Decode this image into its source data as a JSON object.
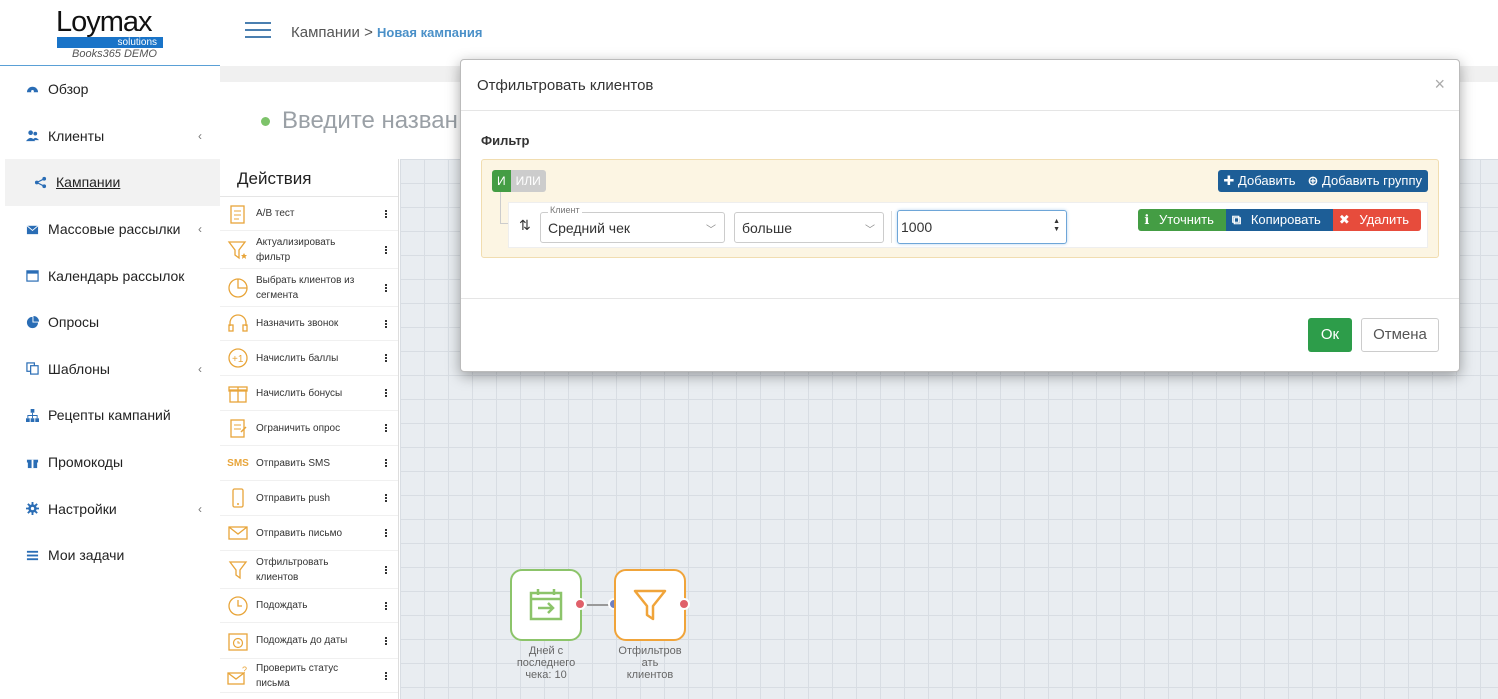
{
  "logo": {
    "brand": "Loymax",
    "tagline": "solutions",
    "instance": "Books365 DEMO"
  },
  "sidebar": {
    "items": [
      {
        "label": "Обзор",
        "icon": "dashboard-icon",
        "chevron": false
      },
      {
        "label": "Клиенты",
        "icon": "users-icon",
        "chevron": true
      },
      {
        "label": "Кампании",
        "icon": "share-icon",
        "chevron": false,
        "active": true
      },
      {
        "label": "Массовые рассылки",
        "icon": "envelope-icon",
        "chevron": true
      },
      {
        "label": "Календарь рассылок",
        "icon": "calendar-icon",
        "chevron": false
      },
      {
        "label": "Опросы",
        "icon": "pie-chart-icon",
        "chevron": false
      },
      {
        "label": "Шаблоны",
        "icon": "copy-icon",
        "chevron": true
      },
      {
        "label": "Рецепты кампаний",
        "icon": "sitemap-icon",
        "chevron": false
      },
      {
        "label": "Промокоды",
        "icon": "gift-icon",
        "chevron": false
      },
      {
        "label": "Настройки",
        "icon": "gear-icon",
        "chevron": true
      },
      {
        "label": "Мои задачи",
        "icon": "tasks-icon",
        "chevron": false
      }
    ]
  },
  "header": {
    "breadcrumb_root": "Кампании",
    "breadcrumb_sep": ">",
    "breadcrumb_current": "Новая кампания"
  },
  "campaign": {
    "name_placeholder": "Введите назван"
  },
  "actions": {
    "title": "Действия",
    "items": [
      {
        "label": "A/B тест",
        "icon": "ab-test-icon"
      },
      {
        "label": "Актуализировать фильтр",
        "icon": "filter-star-icon"
      },
      {
        "label": "Выбрать клиентов из сегмента",
        "icon": "segment-pie-icon"
      },
      {
        "label": "Назначить звонок",
        "icon": "headset-icon"
      },
      {
        "label": "Начислить баллы",
        "icon": "plus-one-icon"
      },
      {
        "label": "Начислить бонусы",
        "icon": "gift-icon"
      },
      {
        "label": "Ограничить опрос",
        "icon": "survey-icon"
      },
      {
        "label": "Отправить SMS",
        "icon": "sms-icon"
      },
      {
        "label": "Отправить push",
        "icon": "mobile-icon"
      },
      {
        "label": "Отправить письмо",
        "icon": "envelope-icon"
      },
      {
        "label": "Отфильтровать клиентов",
        "icon": "filter-icon"
      },
      {
        "label": "Подождать",
        "icon": "clock-icon"
      },
      {
        "label": "Подождать до даты",
        "icon": "calendar-clock-icon"
      },
      {
        "label": "Проверить статус письма",
        "icon": "mail-question-icon"
      }
    ]
  },
  "canvas": {
    "nodes": [
      {
        "label": "Дней с последнего чека: 10",
        "icon": "calendar-arrow-icon",
        "color": "#8cc46a"
      },
      {
        "label": "Отфильтровать клиентов",
        "label_lines": [
          "Отфильтров",
          "ать",
          "клиентов"
        ],
        "icon": "filter-icon",
        "color": "#f0a43a"
      }
    ]
  },
  "modal": {
    "title": "Отфильтровать клиентов",
    "close": "×",
    "filter_label": "Фильтр",
    "and_label": "И",
    "or_label": "ИЛИ",
    "add_label": "Добавить",
    "add_group_label": "Добавить группу",
    "rule": {
      "field_caption": "Клиент",
      "field_value": "Средний чек",
      "operator_value": "больше",
      "value": "1000",
      "refine_label": "Уточнить",
      "copy_label": "Копировать",
      "delete_label": "Удалить"
    },
    "ok_label": "Ок",
    "cancel_label": "Отмена"
  },
  "colors": {
    "accent": "#1d5e97",
    "success": "#2d9d4a",
    "danger": "#e74c3c",
    "refine": "#449d44",
    "link": "#4a90c8"
  }
}
